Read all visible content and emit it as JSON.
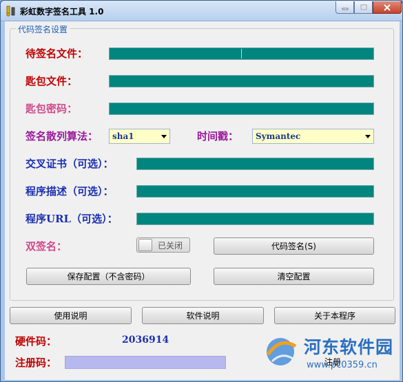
{
  "window": {
    "title": "彩虹数字签名工具 1.0"
  },
  "group": {
    "legend": "代码签名设置"
  },
  "fields": {
    "file_to_sign": {
      "label": "待签名文件：",
      "value": ""
    },
    "key_file": {
      "label": "匙包文件：",
      "value": ""
    },
    "key_password": {
      "label": "匙包密码：",
      "value": ""
    },
    "hash_algorithm": {
      "label": "签名散列算法：",
      "selected": "sha1"
    },
    "timestamp": {
      "label": "时间戳：",
      "selected": "Symantec"
    },
    "cross_cert": {
      "label": "交叉证书（可选）：",
      "value": ""
    },
    "program_desc": {
      "label": "程序描述（可选）：",
      "value": ""
    },
    "program_url": {
      "label": "程序URL（可选）：",
      "value": ""
    },
    "dual_sign": {
      "label": "双签名：",
      "toggle_state": "已关闭"
    }
  },
  "buttons": {
    "code_sign": "代码签名(S)",
    "save_config": "保存配置（不含密码）",
    "clear_config": "清空配置",
    "usage": "使用说明",
    "software_info": "软件说明",
    "about": "关于本程序",
    "register": "注册"
  },
  "bottom": {
    "hardware_label": "硬件码：",
    "hardware_value": "2036914",
    "reg_label": "注册码：",
    "reg_value": ""
  },
  "watermark": {
    "name": "河东软件园",
    "url": "www.pc0359.cn"
  },
  "colors": {
    "field_fill": "#00857f",
    "combo_fill": "#ffffc8",
    "red_label": "#c00000",
    "pink_label": "#d14a8b",
    "purple_label": "#9a1b9a",
    "blue_label": "#1b2fb0"
  }
}
